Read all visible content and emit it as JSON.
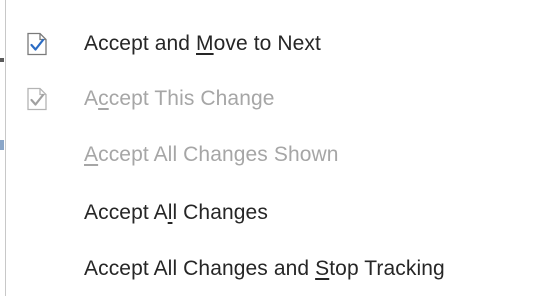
{
  "menu": {
    "items": [
      {
        "before": "Accept and ",
        "accel": "M",
        "after": "ove to Next",
        "enabled": true,
        "icon": "accept-change-icon"
      },
      {
        "before": "A",
        "accel": "c",
        "after": "cept This Change",
        "enabled": false,
        "icon": "accept-change-icon"
      },
      {
        "before": "",
        "accel": "A",
        "after": "ccept All Changes Shown",
        "enabled": false,
        "icon": ""
      },
      {
        "before": "Accept A",
        "accel": "l",
        "after": "l Changes",
        "enabled": true,
        "icon": ""
      },
      {
        "before": "Accept All Changes and ",
        "accel": "S",
        "after": "top Tracking",
        "enabled": true,
        "icon": ""
      }
    ]
  },
  "colors": {
    "text": "#262626",
    "disabled_text": "#a6a6a6",
    "check_accent": "#2b6cc4",
    "menu_border": "#c8c8c8"
  }
}
